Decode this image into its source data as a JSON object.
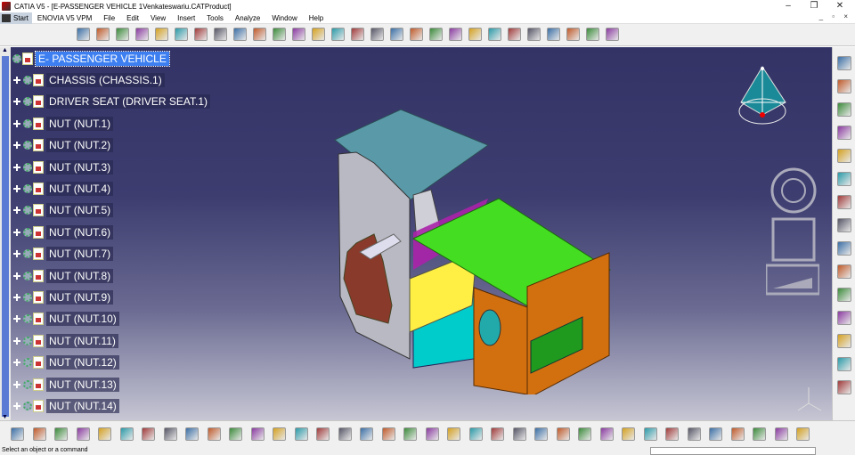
{
  "window": {
    "title": "CATIA V5 - [E-PASSENGER VEHICLE 1Venkateswariu.CATProduct]",
    "controls": {
      "minimize": "–",
      "restore": "❐",
      "close": "✕"
    }
  },
  "menu": {
    "start": "Start",
    "items": [
      "ENOVIA V5 VPM",
      "File",
      "Edit",
      "View",
      "Insert",
      "Tools",
      "Analyze",
      "Window",
      "Help"
    ],
    "mdi_controls": "_ ▫ ×"
  },
  "tree": {
    "root": "E- PASSENGER VEHICLE",
    "nodes": [
      "CHASSIS (CHASSIS.1)",
      "DRIVER SEAT (DRIVER SEAT.1)",
      "NUT (NUT.1)",
      "NUT (NUT.2)",
      "NUT (NUT.3)",
      "NUT (NUT.4)",
      "NUT (NUT.5)",
      "NUT (NUT.6)",
      "NUT (NUT.7)",
      "NUT (NUT.8)",
      "NUT (NUT.9)",
      "NUT (NUT.10)",
      "NUT (NUT.11)",
      "NUT (NUT.12)",
      "NUT (NUT.13)",
      "NUT (NUT.14)"
    ]
  },
  "status": {
    "message": "Select an object or a command",
    "command_input_value": ""
  },
  "colors": {
    "viewport_top": "#333366",
    "viewport_bottom": "#c6c6d4",
    "selection": "#3d7ff0",
    "vehicle_roof": "#44dd22",
    "vehicle_body": "#d27010",
    "vehicle_cabin": "#00cccc",
    "vehicle_windshield_frame": "#5a9aa8"
  },
  "icons": {
    "top_toolbar": [
      "product-icon",
      "component-icon",
      "part-icon",
      "existing-component-icon",
      "replace-component-icon",
      "graph-tree-icon",
      "generate-numbering-icon",
      "selective-load-icon",
      "manage-representations-icon",
      "multi-instantiation-icon",
      "fast-multi-instantiation-icon",
      "manipulation-icon",
      "snap-icon",
      "explode-icon",
      "stop-manipulation-icon",
      "coincidence-constraint-icon",
      "contact-constraint-icon",
      "offset-constraint-icon",
      "angle-constraint-icon",
      "fix-constraint-icon",
      "fix-together-icon",
      "quick-constraint-icon",
      "flexible-subassembly-icon",
      "change-constraint-icon",
      "reuse-pattern-icon",
      "update-icon",
      "scene-icon",
      "catalog-icon"
    ],
    "bottom_toolbar": [
      "new-icon",
      "open-icon",
      "save-icon",
      "print-icon",
      "cut-icon",
      "copy-icon",
      "paste-icon",
      "undo-icon",
      "redo-icon",
      "whats-this-icon",
      "fly-mode-icon",
      "fit-all-icon",
      "pan-icon",
      "rotate-icon",
      "zoom-in-icon",
      "zoom-out-icon",
      "normal-view-icon",
      "multi-view-icon",
      "iso-view-icon",
      "shading-icon",
      "hide-show-icon",
      "swap-space-icon",
      "formula-icon",
      "measure-icon",
      "knowledge-icon",
      "table-icon",
      "sketch-icon",
      "macro-icon",
      "bom-icon",
      "parameters-icon",
      "clash-icon",
      "sectioning-icon",
      "camera-icon",
      "publish-icon",
      "compare-icon",
      "lock-icon",
      "catia-logo-icon"
    ],
    "right_toolbar": [
      "material-icon",
      "render-icon",
      "measure-between-icon",
      "measure-item-icon",
      "measure-inertia-icon",
      "cursor-icon",
      "annotation-icon",
      "text-icon",
      "weld-icon",
      "axis-icon",
      "paint-icon",
      "clash-analysis-icon",
      "section-icon",
      "distance-icon",
      "scene-edit-icon"
    ]
  }
}
